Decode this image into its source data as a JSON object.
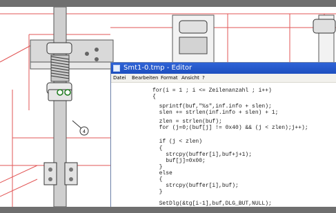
{
  "editor": {
    "title": "Smt1-0.tmp - Editor",
    "menu": [
      "Datei",
      "Bearbeiten",
      "Format",
      "Ansicht",
      "?"
    ],
    "code": [
      "for(i = 1 ; i <= Zeilenanzahl ; i++)",
      "{",
      "  sprintf(buf,\"%s\",inf.info + slen);",
      "  slen += strlen(inf.info + slen) + 1;",
      "  zlen = strlen(buf);",
      "  for (j=0;(buf[j] != 0x40) && (j < zlen);j++);",
      "  if (j < zlen)",
      "  {",
      "    strcpy(buffer[i],buf+j+1);",
      "    buf[j]=0x00;",
      "  }",
      "  else",
      "  {",
      "    strcpy(buffer[i],buf);",
      "  }",
      "  SetDlg(&tg[i-1],buf,DLG_BUT,NULL);"
    ]
  },
  "drawing": {
    "callout": "4",
    "line_color": "#e25555"
  }
}
